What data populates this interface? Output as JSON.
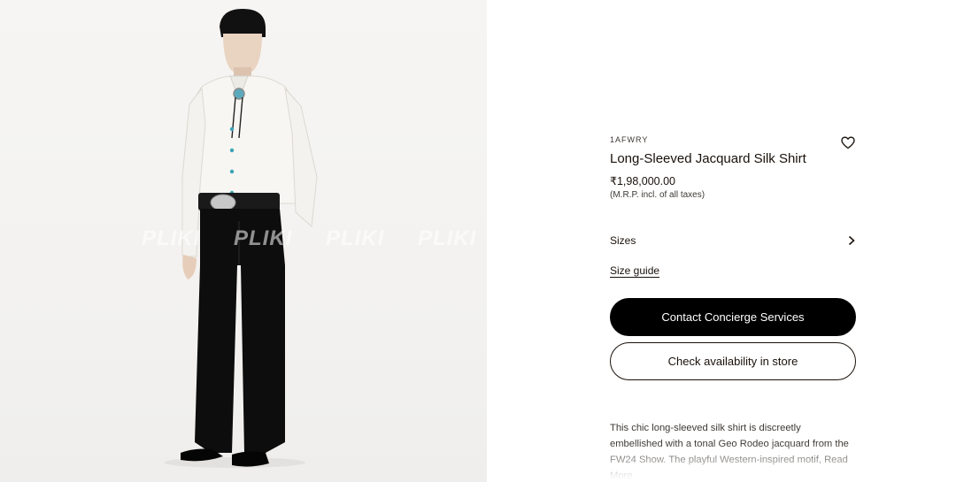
{
  "image": {
    "alt": "Model wearing long-sleeved white jacquard silk shirt with bolo tie, black belt and flared trousers",
    "watermark": "PLIKI PLIKI PLIKI PLIKI PLIKI"
  },
  "product": {
    "sku": "1AFWRY",
    "name": "Long-Sleeved Jacquard Silk Shirt",
    "price": "₹1,98,000.00",
    "tax_note": "(M.R.P. incl. of all taxes)",
    "wishlist_icon": "heart-icon"
  },
  "sizes": {
    "label": "Sizes",
    "icon": "chevron-right-icon"
  },
  "size_guide": "Size guide",
  "buttons": {
    "concierge": "Contact Concierge Services",
    "availability": "Check availability in store"
  },
  "description": "This chic long-sleeved silk shirt is discreetly embellished with a tonal Geo Rodeo jacquard from the FW24 Show. The playful Western-inspired motif, Read More",
  "colors": {
    "primary_button_bg": "#000000",
    "text": "#19110b",
    "image_bg": "#f4f3f1"
  }
}
